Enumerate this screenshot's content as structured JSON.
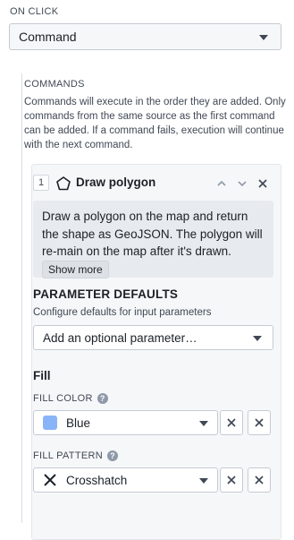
{
  "on_click": {
    "label": "ON CLICK",
    "selected": "Command"
  },
  "commands": {
    "label": "COMMANDS",
    "description": "Commands will execute in the order they are added. Only commands from the same source as the first command can be added. If a command fails, execution will continue with the next command.",
    "items": [
      {
        "index": "1",
        "icon": "polygon-icon",
        "title": "Draw polygon",
        "description": "Draw a polygon on the map and return the shape as GeoJSON. The polygon will re-main on the map after it's drawn. Styling…",
        "show_more": "Show more",
        "parameter_defaults": {
          "heading": "PARAMETER DEFAULTS",
          "subtitle": "Configure defaults for input parameters",
          "add_placeholder": "Add an optional parameter…"
        },
        "fill": {
          "heading": "Fill",
          "color": {
            "label": "FILL COLOR",
            "value": "Blue",
            "swatch": "#8ab4f8"
          },
          "pattern": {
            "label": "FILL PATTERN",
            "value": "Crosshatch",
            "icon": "cross-icon"
          }
        }
      }
    ]
  }
}
